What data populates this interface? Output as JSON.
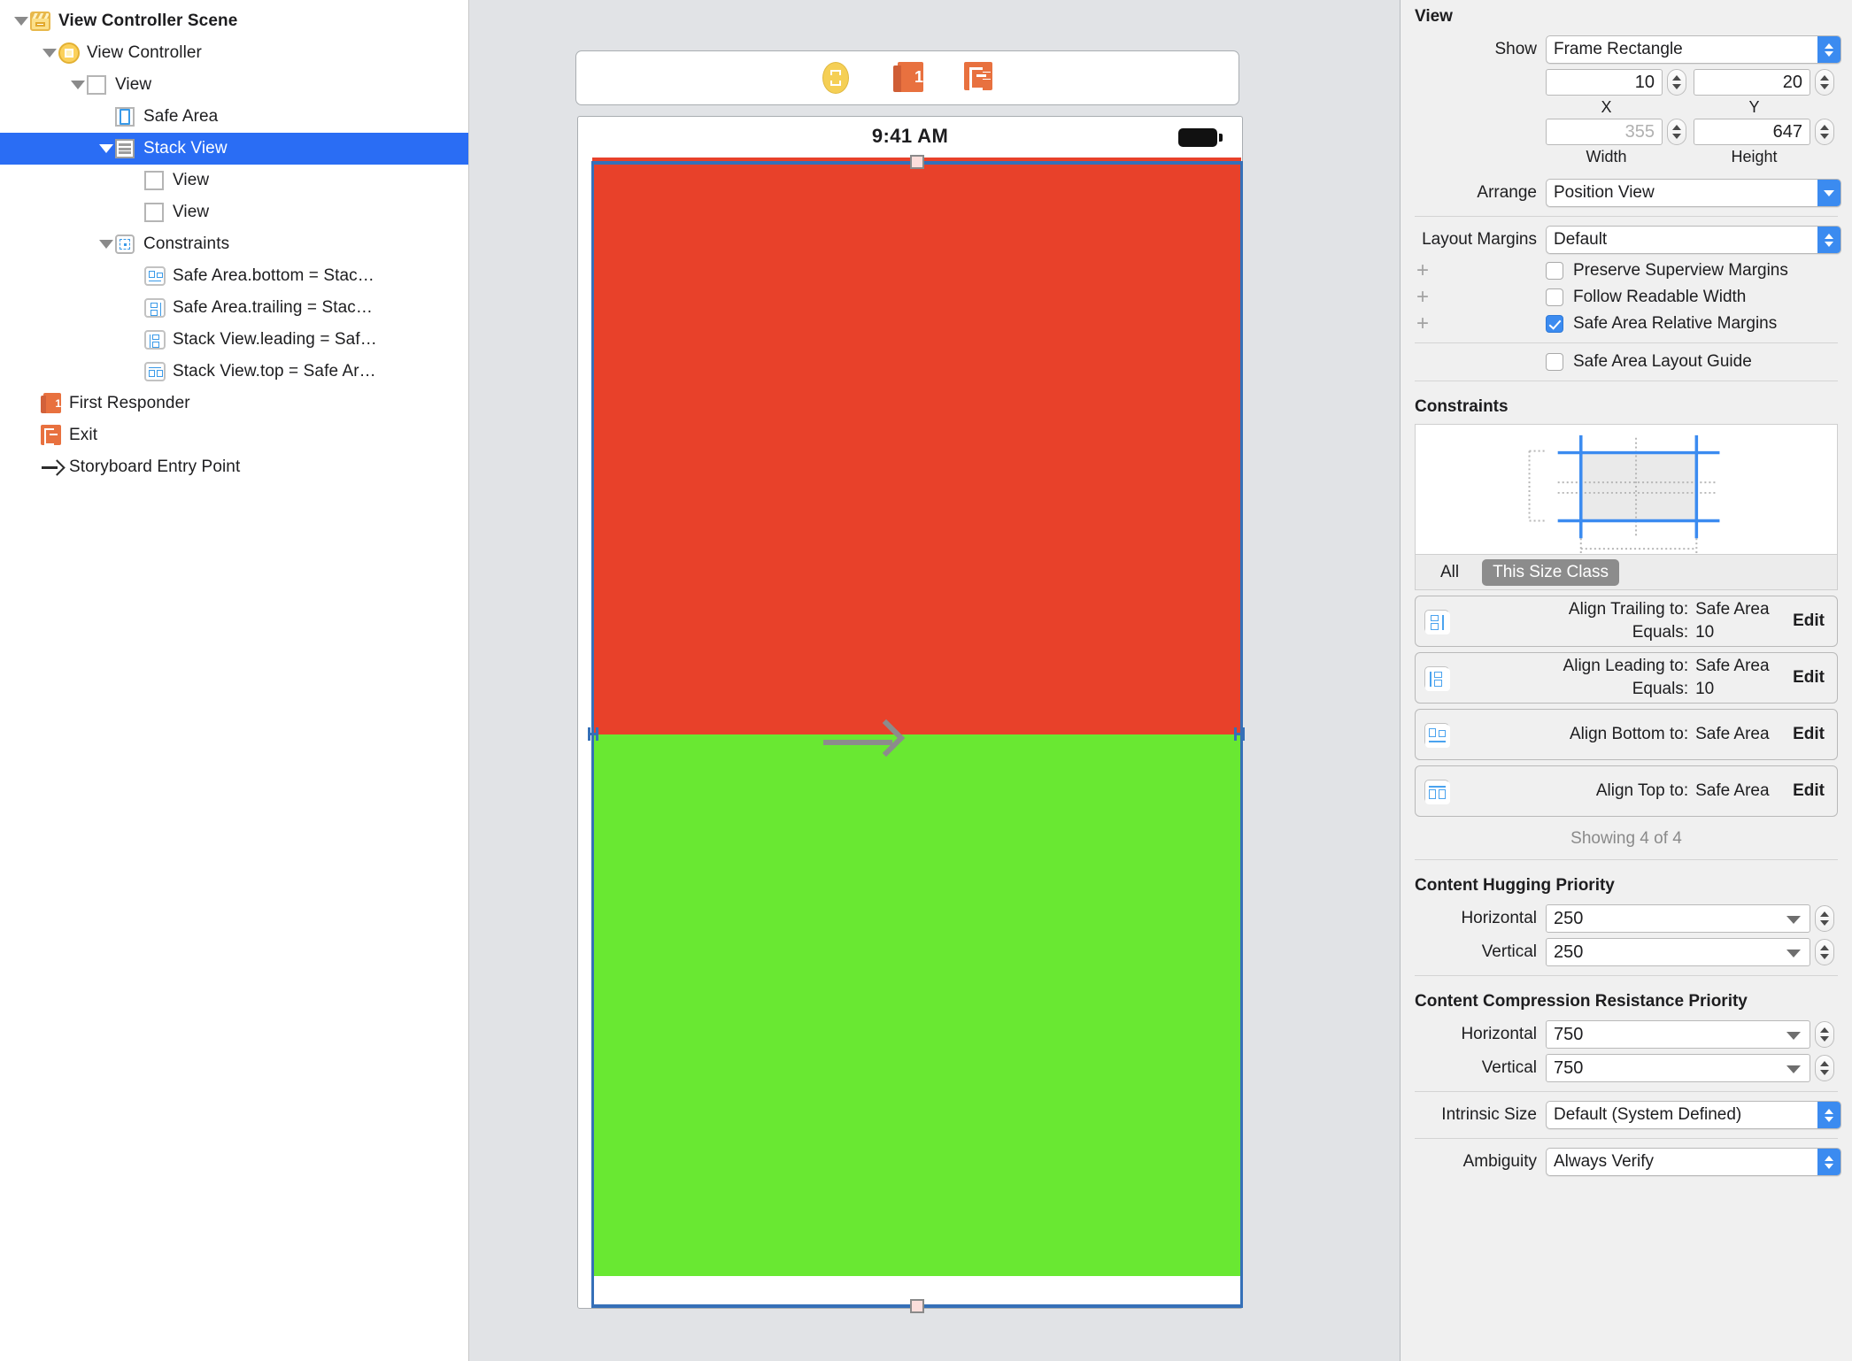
{
  "outline": {
    "items": [
      {
        "label": "View Controller Scene",
        "icon": "scene-icon",
        "depth": 0,
        "twisty": "open",
        "bold": true,
        "selected": false
      },
      {
        "label": "View Controller",
        "icon": "view-controller-icon",
        "depth": 1,
        "twisty": "open",
        "bold": false,
        "selected": false
      },
      {
        "label": "View",
        "icon": "view-icon",
        "depth": 2,
        "twisty": "open",
        "bold": false,
        "selected": false
      },
      {
        "label": "Safe Area",
        "icon": "safe-area-icon",
        "depth": 3,
        "twisty": "none",
        "bold": false,
        "selected": false
      },
      {
        "label": "Stack View",
        "icon": "stack-view-icon",
        "depth": 3,
        "twisty": "open",
        "bold": false,
        "selected": true
      },
      {
        "label": "View",
        "icon": "view-icon",
        "depth": 4,
        "twisty": "none",
        "bold": false,
        "selected": false
      },
      {
        "label": "View",
        "icon": "view-icon",
        "depth": 4,
        "twisty": "none",
        "bold": false,
        "selected": false
      },
      {
        "label": "Constraints",
        "icon": "constraints-folder-icon",
        "depth": 3,
        "twisty": "open",
        "bold": false,
        "selected": false
      },
      {
        "label": "Safe Area.bottom = Stac…",
        "icon": "constraint-bottom-icon",
        "depth": 4,
        "twisty": "none",
        "bold": false,
        "selected": false
      },
      {
        "label": "Safe Area.trailing = Stac…",
        "icon": "constraint-trailing-icon",
        "depth": 4,
        "twisty": "none",
        "bold": false,
        "selected": false
      },
      {
        "label": "Stack View.leading = Saf…",
        "icon": "constraint-leading-icon",
        "depth": 4,
        "twisty": "none",
        "bold": false,
        "selected": false
      },
      {
        "label": "Stack View.top = Safe Ar…",
        "icon": "constraint-top-icon",
        "depth": 4,
        "twisty": "none",
        "bold": false,
        "selected": false
      },
      {
        "label": "First Responder",
        "icon": "first-responder-icon",
        "depth": 1,
        "twisty": "none",
        "bold": false,
        "selected": false
      },
      {
        "label": "Exit",
        "icon": "exit-icon",
        "depth": 1,
        "twisty": "none",
        "bold": false,
        "selected": false
      },
      {
        "label": "Storyboard Entry Point",
        "icon": "entry-point-arrow-icon",
        "depth": 1,
        "twisty": "none",
        "bold": false,
        "selected": false
      }
    ]
  },
  "canvas": {
    "scene_dock": {
      "icons": [
        "view-controller-icon",
        "first-responder-icon",
        "exit-icon"
      ]
    },
    "device": {
      "status_time": "9:41 AM",
      "battery": "battery-full-icon",
      "stack_views": [
        {
          "name": "top-view",
          "color": "#e8412a"
        },
        {
          "name": "bottom-view",
          "color": "#69e832"
        }
      ]
    }
  },
  "inspector": {
    "title": "View",
    "show": {
      "label": "Show",
      "value": "Frame Rectangle"
    },
    "frame": {
      "x": {
        "value": "10",
        "caption": "X",
        "dimmed": false
      },
      "y": {
        "value": "20",
        "caption": "Y",
        "dimmed": false
      },
      "width": {
        "value": "355",
        "caption": "Width",
        "dimmed": true
      },
      "height": {
        "value": "647",
        "caption": "Height",
        "dimmed": false
      }
    },
    "arrange": {
      "label": "Arrange",
      "value": "Position View"
    },
    "layout_margins": {
      "label": "Layout Margins",
      "value": "Default"
    },
    "checkboxes": [
      {
        "label": "Preserve Superview Margins",
        "checked": false,
        "plus": "+"
      },
      {
        "label": "Follow Readable Width",
        "checked": false,
        "plus": "+"
      },
      {
        "label": "Safe Area Relative Margins",
        "checked": true,
        "plus": "+"
      }
    ],
    "safe_area_layout_guide": {
      "label": "Safe Area Layout Guide",
      "checked": false
    },
    "constraints": {
      "title": "Constraints",
      "segments": [
        {
          "label": "All",
          "active": false
        },
        {
          "label": "This Size Class",
          "active": true
        }
      ],
      "items": [
        {
          "icon": "constraint-trailing-icon",
          "relation": "Align Trailing to:",
          "target": "Safe Area",
          "equals_label": "Equals:",
          "equals_value": "10",
          "edit": "Edit"
        },
        {
          "icon": "constraint-leading-icon",
          "relation": "Align Leading to:",
          "target": "Safe Area",
          "equals_label": "Equals:",
          "equals_value": "10",
          "edit": "Edit"
        },
        {
          "icon": "constraint-bottom-icon",
          "relation": "Align Bottom to:",
          "target": "Safe Area",
          "equals_label": "",
          "equals_value": "",
          "edit": "Edit"
        },
        {
          "icon": "constraint-top-icon",
          "relation": "Align Top to:",
          "target": "Safe Area",
          "equals_label": "",
          "equals_value": "",
          "edit": "Edit"
        }
      ],
      "showing": "Showing 4 of 4"
    },
    "content_hugging": {
      "title": "Content Hugging Priority",
      "horizontal": {
        "label": "Horizontal",
        "value": "250"
      },
      "vertical": {
        "label": "Vertical",
        "value": "250"
      }
    },
    "content_compression": {
      "title": "Content Compression Resistance Priority",
      "horizontal": {
        "label": "Horizontal",
        "value": "750"
      },
      "vertical": {
        "label": "Vertical",
        "value": "750"
      }
    },
    "intrinsic_size": {
      "label": "Intrinsic Size",
      "value": "Default (System Defined)"
    },
    "ambiguity": {
      "label": "Ambiguity",
      "value": "Always Verify"
    }
  },
  "colors": {
    "selection_blue": "#2a6df4",
    "accent_blue": "#3b8bf0",
    "top_view": "#e8412a",
    "bottom_view": "#69e832",
    "segment_active": "#8c8c8c"
  }
}
